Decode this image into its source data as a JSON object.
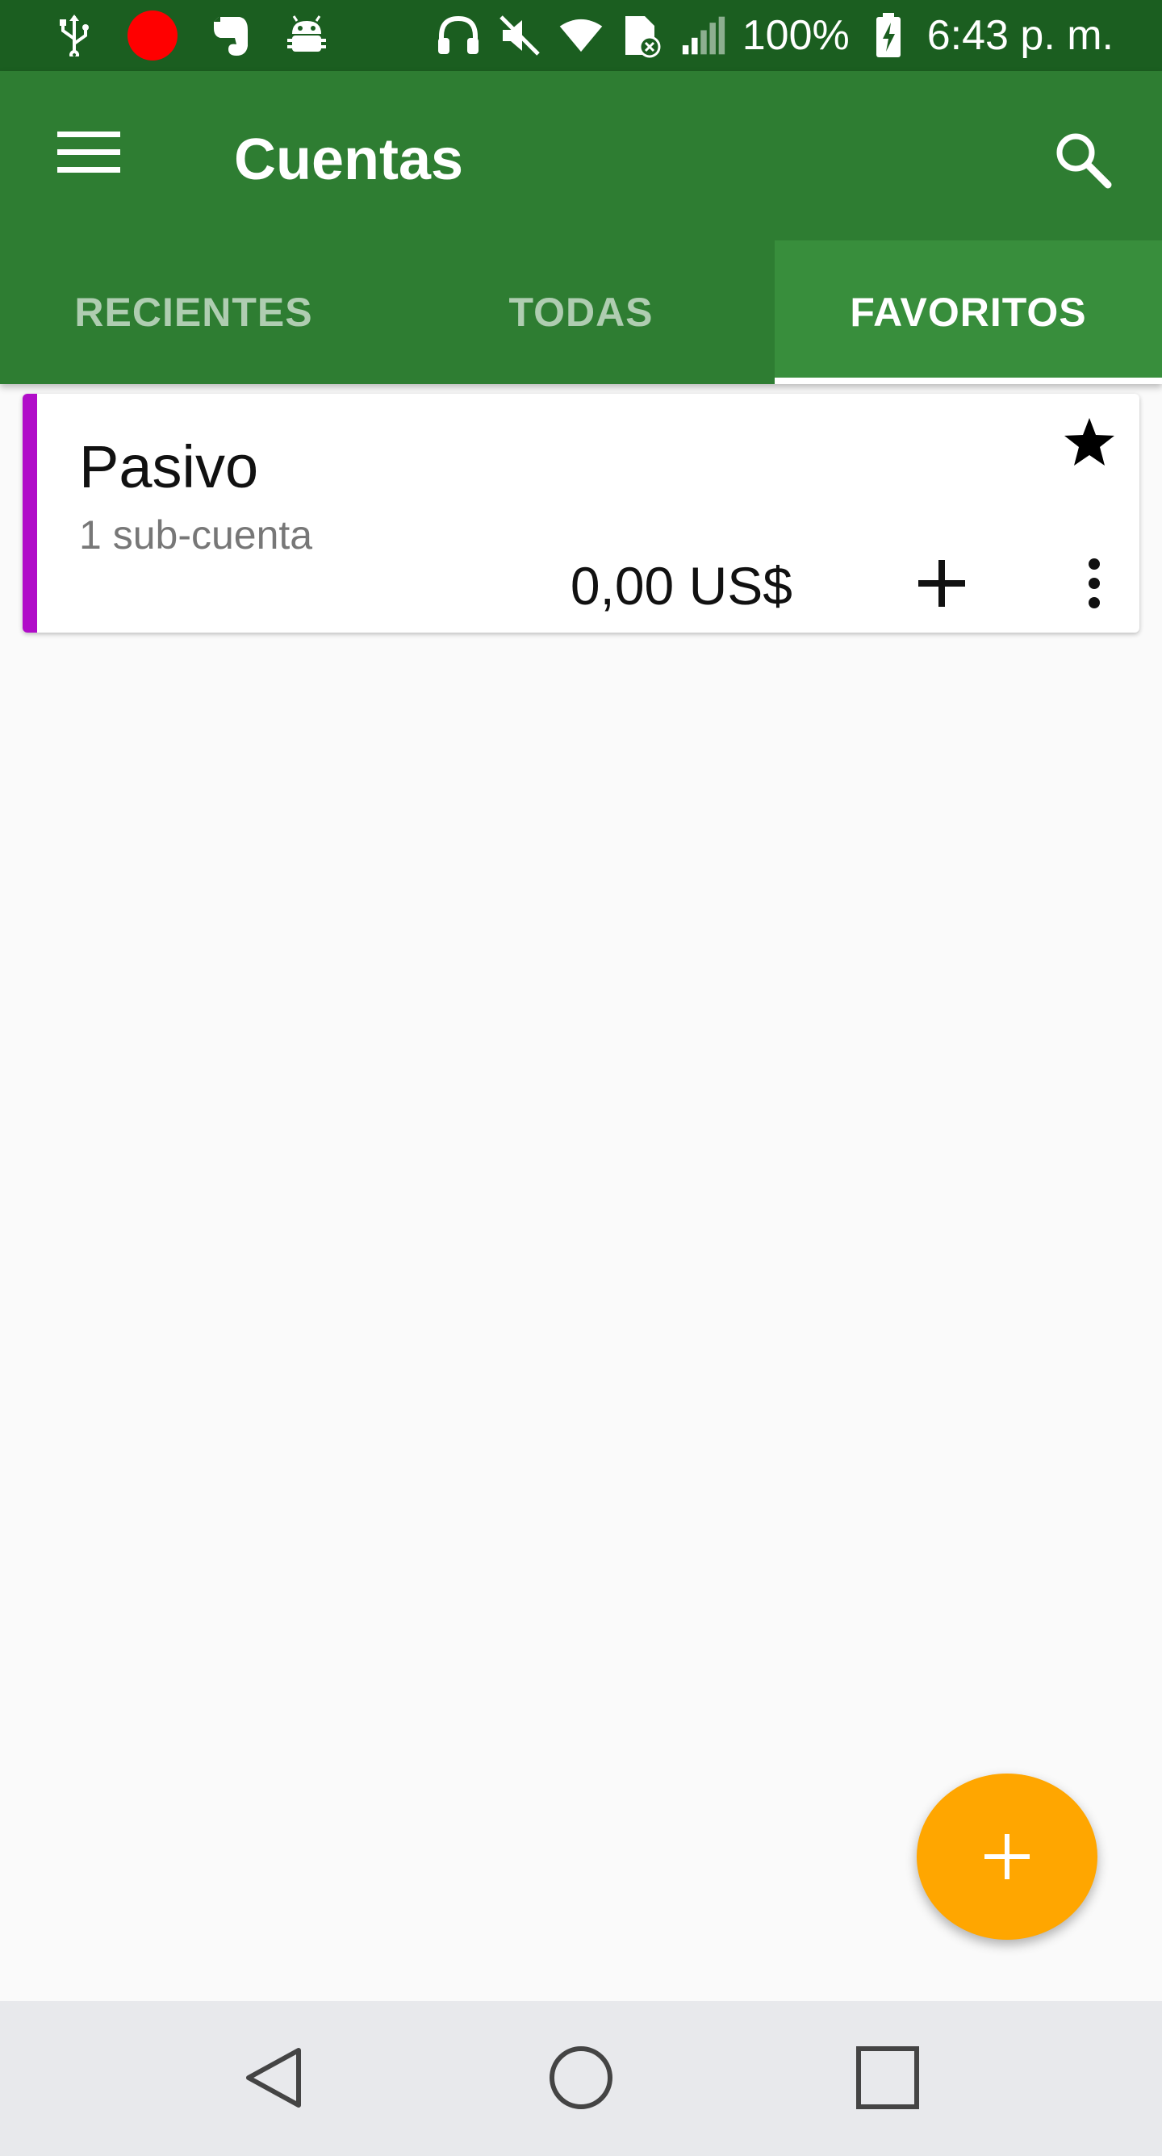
{
  "status_bar": {
    "icons": [
      "usb-icon",
      "record-icon",
      "evernote-icon",
      "android-debug-icon",
      "headphones-icon",
      "mute-icon",
      "wifi-icon",
      "sim-error-icon",
      "signal-icon",
      "battery-charging-icon"
    ],
    "battery": "100%",
    "time": "6:43 p. m."
  },
  "app_bar": {
    "title": "Cuentas",
    "menu_icon": "hamburger-menu-icon",
    "search_icon": "search-icon"
  },
  "tabs": [
    {
      "label": "RECIENTES",
      "active": false
    },
    {
      "label": "TODAS",
      "active": false
    },
    {
      "label": "FAVORITOS",
      "active": true
    }
  ],
  "accounts": [
    {
      "name": "Pasivo",
      "subaccounts": "1 sub-cuenta",
      "balance": "0,00 US$",
      "color": "#b10dc9",
      "favorite": true
    }
  ],
  "colors": {
    "status_bar": "#1b5e20",
    "app_bar": "#2e7d32",
    "fab": "#ffa600",
    "nav_bar": "#e8e9ec"
  },
  "fab": {
    "icon": "plus-icon"
  },
  "nav_bar": {
    "buttons": [
      "back-icon",
      "home-icon",
      "recents-icon"
    ]
  }
}
